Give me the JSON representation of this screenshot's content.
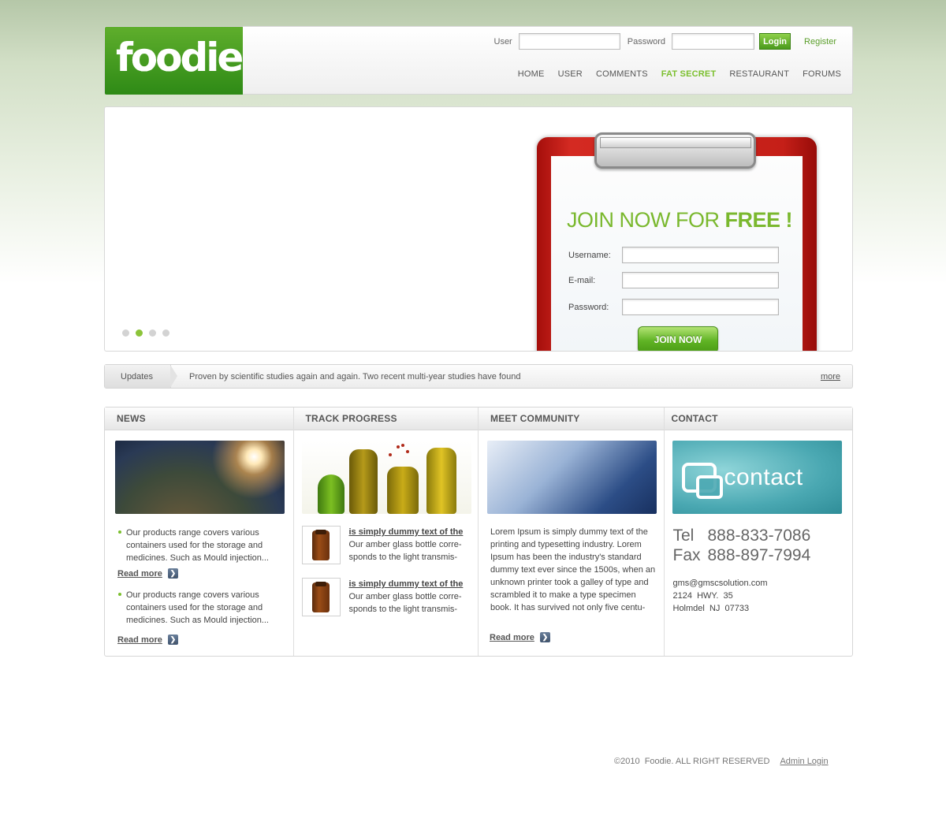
{
  "header": {
    "logo_text": "foodie",
    "user_label": "User",
    "password_label": "Password",
    "login_button": "Login",
    "register_link": "Register",
    "nav": [
      "HOME",
      "USER",
      "COMMENTS",
      "FAT SECRET",
      "RESTAURANT",
      "FORUMS"
    ],
    "active_nav": "FAT SECRET"
  },
  "hero": {
    "join_title_prefix": "JOIN NOW FOR ",
    "join_title_bold": "FREE !",
    "username_label": "Username:",
    "email_label": "E-mail:",
    "password_label": "Password:",
    "join_button": "JOIN NOW",
    "slide_count": 4,
    "active_slide": 2
  },
  "updates": {
    "tab": "Updates",
    "text": "Proven by scientific studies again and again. Two recent multi-year studies have found",
    "more": "more"
  },
  "columns": {
    "news": {
      "title": "NEWS",
      "items": [
        {
          "text": "Our products range covers various containers used for the storage and medicines. Such as Mould injection...",
          "read_more": "Read more"
        },
        {
          "text": "Our products range covers various containers used for the storage and medicines. Such as Mould injection...",
          "read_more": "Read more"
        }
      ]
    },
    "track": {
      "title": "TRACK PROGRESS",
      "items": [
        {
          "title": "is simply dummy text of the",
          "text": "Our amber glass bottle corre- sponds to the light transmis-"
        },
        {
          "title": "is simply dummy text of the",
          "text": "Our amber glass bottle corre- sponds to the light transmis-"
        }
      ]
    },
    "community": {
      "title": "MEET COMMUNITY",
      "text": "Lorem Ipsum is simply dummy text of the printing and typesetting industry. Lorem Ipsum has been the industry's standard dummy text ever since the 1500s, when an unknown printer took a galley of type and scrambled it to make a type specimen book. It has survived not only five centu-",
      "read_more": "Read more"
    },
    "contact": {
      "title": "CONTACT",
      "image_word": "contact",
      "tel_label": "Tel",
      "tel": "888-833-7086",
      "fax_label": "Fax",
      "fax": "888-897-7994",
      "email": "gms@gmscsolution.com",
      "address1": "2124  HWY.  35",
      "address2": "Holmdel  NJ  07733"
    }
  },
  "footer": {
    "copyright": "©2010  Foodie. ALL RIGHT RESERVED",
    "admin_login": "Admin Login"
  },
  "colors": {
    "accent_green": "#7bbf2e",
    "clipboard_red": "#c51f18"
  }
}
